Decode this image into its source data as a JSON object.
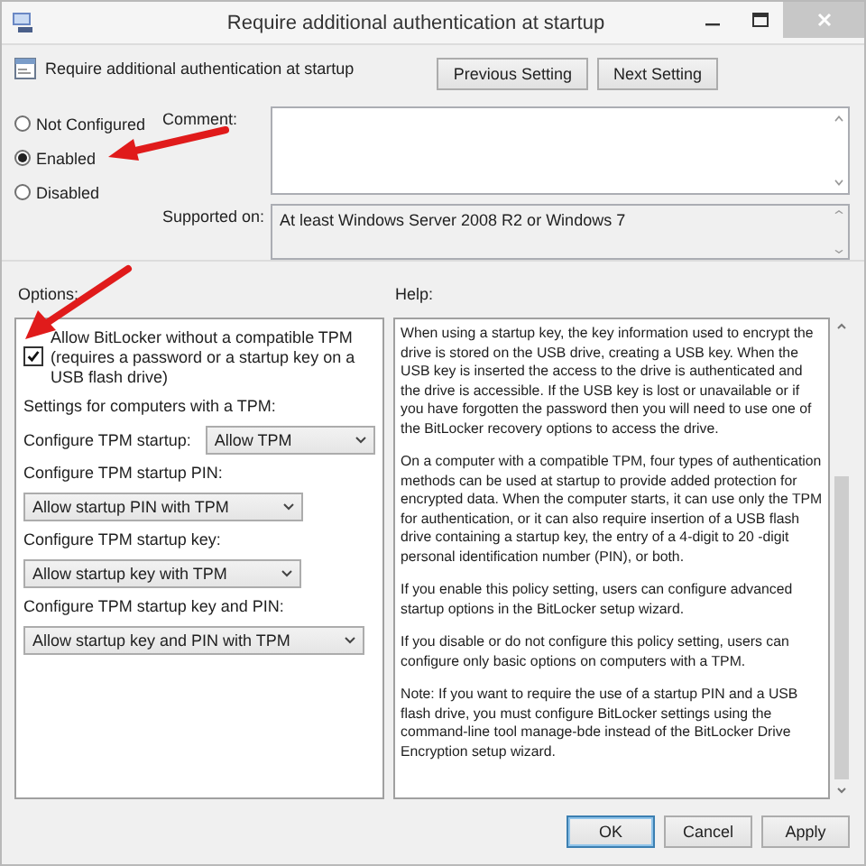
{
  "window": {
    "title": "Require additional authentication at startup"
  },
  "header": {
    "title": "Require additional authentication at startup",
    "buttons": [
      {
        "label": "Previous Setting"
      },
      {
        "label": "Next Setting"
      }
    ]
  },
  "state_options": [
    {
      "label": "Not Configured",
      "selected": false
    },
    {
      "label": "Enabled",
      "selected": true
    },
    {
      "label": "Disabled",
      "selected": false
    }
  ],
  "comment": {
    "label": "Comment:"
  },
  "supported_on": {
    "label": "Supported on:",
    "value": "At least Windows Server 2008 R2 or Windows 7"
  },
  "options": {
    "label": "Options:",
    "items": [
      {
        "kind": "checkbox",
        "label": "Allow BitLocker without a compatible TPM (requires a password or a startup key on a USB flash drive)",
        "checked": true
      },
      {
        "kind": "text",
        "label": "Settings for computers with a TPM:"
      },
      {
        "kind": "inline_select",
        "label": "Configure TPM startup:",
        "value": "Allow TPM"
      },
      {
        "kind": "select",
        "label": "Configure TPM startup PIN:",
        "value": "Allow startup PIN with TPM"
      },
      {
        "kind": "select",
        "label": "Configure TPM startup key:",
        "value": "Allow startup key with TPM"
      },
      {
        "kind": "select",
        "label": "Configure TPM startup key and PIN:",
        "value": "Allow startup key and PIN with TPM"
      }
    ]
  },
  "help": {
    "label": "Help:",
    "paragraphs": [
      "When using a startup key, the key information used to encrypt the drive is stored on the USB drive, creating a USB key. When the USB key is inserted the access to the drive is authenticated and the drive is accessible. If the USB key is lost or unavailable or if you have forgotten the password then you will need to use one of the BitLocker recovery options to access the drive.",
      "On a computer with a compatible TPM, four types of authentication methods can be used at startup to provide added protection for encrypted data. When the computer starts, it can use only the TPM for authentication, or it can also require insertion of a USB flash drive containing a startup key, the entry of a 4-digit to 20 -digit personal identification number (PIN), or both.",
      "If you enable this policy setting, users can configure advanced startup options in the BitLocker setup wizard.",
      "If you disable or do not configure this policy setting, users can configure only basic options on computers with a TPM.",
      "Note: If you want to require the use of a startup PIN and a USB flash drive, you must configure BitLocker settings using the command-line tool manage-bde instead of the BitLocker Drive Encryption setup wizard."
    ]
  },
  "buttons": [
    {
      "label": "OK",
      "default": true
    },
    {
      "label": "Cancel",
      "default": false
    },
    {
      "label": "Apply",
      "default": false
    }
  ]
}
